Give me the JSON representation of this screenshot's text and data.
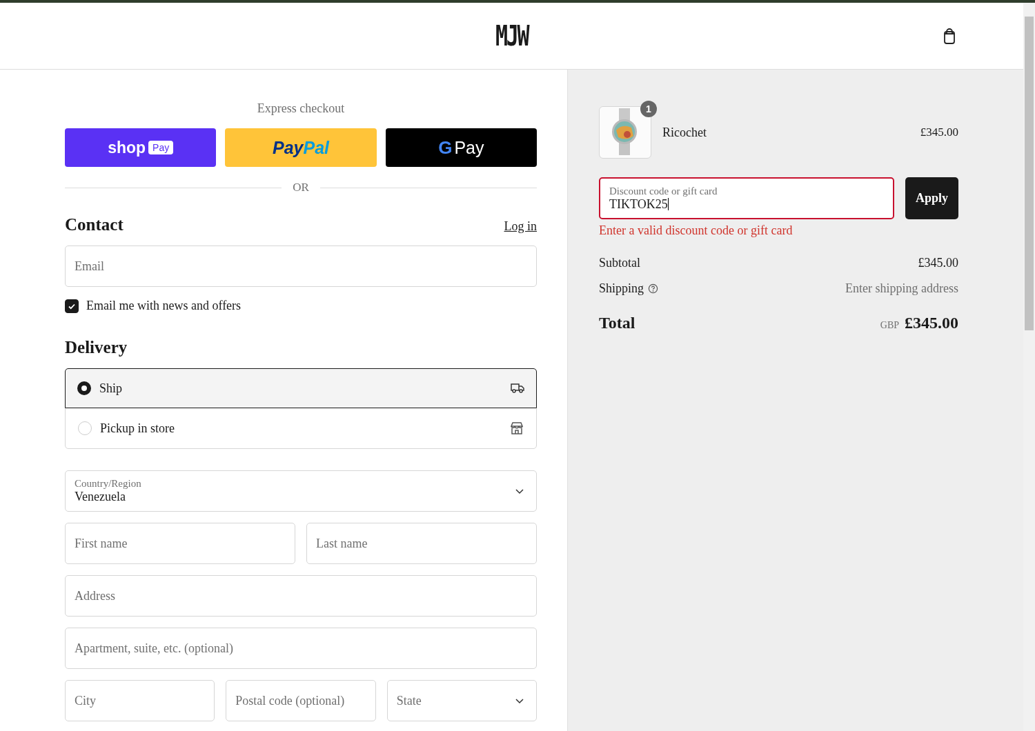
{
  "header": {
    "logo": "MJW"
  },
  "express": {
    "title": "Express checkout",
    "buttons": [
      {
        "kind": "shoppay",
        "label": "shop",
        "badge": "Pay"
      },
      {
        "kind": "paypal",
        "label": "Pay",
        "label2": "Pal"
      },
      {
        "kind": "gpay",
        "label": "G",
        "label2": "Pay"
      }
    ],
    "divider": "OR"
  },
  "contact": {
    "heading": "Contact",
    "login": "Log in",
    "email": {
      "placeholder": "Email"
    },
    "newsletter": {
      "label": "Email me with news and offers",
      "checked": true
    }
  },
  "delivery": {
    "heading": "Delivery",
    "options": [
      {
        "kind": "ship",
        "label": "Ship",
        "selected": true
      },
      {
        "kind": "store",
        "label": "Pickup in store",
        "selected": false
      }
    ],
    "country": {
      "label": "Country/Region",
      "value": "Venezuela"
    },
    "rows": [
      [
        {
          "kind": "input",
          "placeholder": "First name"
        },
        {
          "kind": "input",
          "placeholder": "Last name"
        }
      ],
      [
        {
          "kind": "input",
          "placeholder": "Address"
        }
      ],
      [
        {
          "kind": "input",
          "placeholder": "Apartment, suite, etc. (optional)"
        }
      ],
      [
        {
          "kind": "input",
          "placeholder": "City"
        },
        {
          "kind": "input",
          "placeholder": "Postal code (optional)"
        },
        {
          "kind": "select",
          "placeholder": "State"
        }
      ]
    ]
  },
  "summary": {
    "items": [
      {
        "name": "Ricochet",
        "quantity": "1",
        "price": "£345.00"
      }
    ],
    "discount": {
      "label": "Discount code or gift card",
      "value": "TIKTOK25",
      "error": "Enter a valid discount code or gift card",
      "button": "Apply"
    },
    "subtotal": {
      "label": "Subtotal",
      "value": "£345.00"
    },
    "shipping": {
      "label": "Shipping",
      "value": "Enter shipping address"
    },
    "total": {
      "label": "Total",
      "currency": "GBP",
      "value": "£345.00"
    }
  }
}
